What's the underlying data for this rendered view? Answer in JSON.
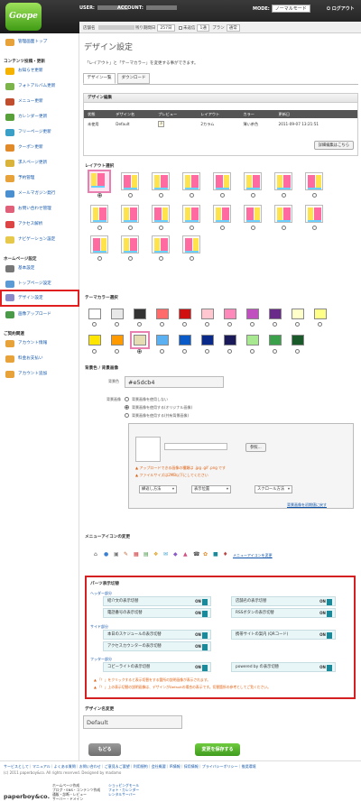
{
  "header": {
    "logo": "Goope",
    "user_label": "USER:",
    "account_label": "ACCOUNT:",
    "mode_label": "MODE:",
    "mode_value": "ノーマルモード",
    "logout": "ログアウト"
  },
  "strip": {
    "shop_label": "店舗名",
    "days_label": "残り期間日",
    "days_value": "257日",
    "unanswered_label": "未返信",
    "unanswered_value": "1通",
    "plan_label": "プラン",
    "plan_value": "通常"
  },
  "sidebar": {
    "top": "管理画面トップ",
    "content_heading": "コンテンツ投稿・更新",
    "items": [
      "お知らせ更新",
      "フォトアルバム更新",
      "メニュー更新",
      "カレンダー更新",
      "フリーページ更新",
      "クーポン更新",
      "求人ページ更新",
      "予約管理",
      "メールマガジン発行",
      "お問い合わせ管理",
      "アクセス解析",
      "ナビゲーション設定"
    ],
    "settings_heading": "ホームページ設定",
    "settings_items": [
      "基本設定",
      "トップページ設定",
      "店舗情報設定",
      "デザイン設定",
      "画像アップロード"
    ],
    "contract_heading": "ご契約関連",
    "contract_items": [
      "アカウント情報",
      "料金お支払い",
      "アカウント追加"
    ]
  },
  "main": {
    "title": "デザイン設定",
    "lead": "「レイアウト」と「テーマカラー」を変更する事ができます。",
    "tabs": [
      "デザイン一覧",
      "ダウンロード"
    ],
    "design_section": "デザイン編集",
    "table_headers": [
      "状態",
      "デザイン名",
      "プレビュー",
      "レイアウト",
      "カラー",
      "更新日"
    ],
    "table_row": [
      "未使用",
      "Default",
      "",
      "2カラム",
      "薄い茶色",
      "2011-09-07 13:21:51"
    ],
    "detail_button": "詳細編集はこちら",
    "layout_section": "レイアウト選択",
    "theme_section": "テーマカラー選択",
    "bg_section": "背景色 / 背景画像",
    "bg_color_label": "背景色",
    "bg_color_value": "#e5dcb4",
    "bg_image_label": "背景画像",
    "bg_options": [
      "背景画像を使用しない",
      "背景画像を使用する(オリジナル画像)",
      "背景画像を使用する(共有背景画像)"
    ],
    "browse_button": "参照...",
    "warn1": "アップロードできる画像の種類は .jpg .gif .png です",
    "warn2": "ファイルサイズは2MB以下にしてください",
    "repeat_select": "繰返し方法",
    "position_select": "表示位置",
    "scroll_select": "スクロール方法",
    "reset_link": "背景画像を初期値に戻す",
    "menu_icon_section": "メニューアイコンの変更",
    "menu_icon_link": "メニューアイコンを変更",
    "parts_section": "パーツ表示切替",
    "header_group": "ヘッダー部分",
    "side_group": "サイド部分",
    "footer_group": "フッター部分",
    "toggles": {
      "intro": "紹介文の表示切替",
      "shop_name": "店舗名の表示切替",
      "phone": "電話番号の表示切替",
      "rss": "RSSボタンの表示切替",
      "schedule": "本日のスケジュールの表示切替",
      "mobile": "携帯サイトの案内 (QRコード)",
      "counter": "アクセスカウンターの表示切替",
      "copyright": "コピーライトの表示切替",
      "poweredby": "powered by の表示切替"
    },
    "on_label": "ON",
    "note1": "「！」をクリックすると表示切替をする箇所の説明画像が表示されます。",
    "note2": "「！」上の表示切替の説明画像は、デザインがDefaultの場合の表示です。切替箇所の参考としてご覧ください。",
    "design_name_section": "デザイン名変更",
    "design_name_value": "Default",
    "back_button": "もどる",
    "save_button": "変更を保存する"
  },
  "footer": {
    "links": "サービスとして｜マニュアル｜よくある質問｜お問い合わせ｜ご意見＆ご要望｜利用規約｜会社概要｜IR情報｜採用情報｜プライバシーポリシー｜推奨環境",
    "copyright": "(c) 2011 paperboy&co. All rights reserved. Designed by madamo",
    "brand": "paperboy&co.",
    "col1": [
      "ホームページ作成",
      "ブログ・SNS・コンテンツ作成",
      "通販・診断・レビュー",
      "サーバー・ドメイン"
    ],
    "col2": [
      "ショッピングモール",
      "フォト・カレンダー",
      "レンタルサーバー"
    ]
  },
  "colors": {
    "accent": "#1a8a9a",
    "highlight": "#d42020",
    "save": "#4caf2a"
  }
}
